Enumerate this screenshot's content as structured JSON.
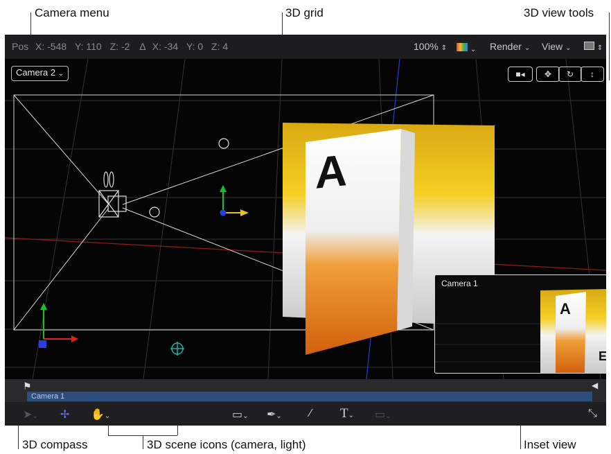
{
  "callouts": {
    "camera_menu": "Camera menu",
    "grid_3d": "3D grid",
    "view_tools": "3D view tools",
    "compass": "3D compass",
    "scene_icons": "3D scene icons (camera, light)",
    "inset_view": "Inset view"
  },
  "status": {
    "pos_label": "Pos",
    "x": "X: -548",
    "y": "Y: 110",
    "z": "Z: -2",
    "delta": "Δ",
    "dx": "X: -34",
    "dy": "Y: 0",
    "dz": "Z: 4",
    "zoom": "100%",
    "render": "Render",
    "view": "View"
  },
  "camera_menu": {
    "selected": "Camera 2"
  },
  "poster": {
    "letter": "A"
  },
  "timeline": {
    "track_label": "Camera 1"
  },
  "inset": {
    "title": "Camera 1",
    "letter": "A",
    "corner_letter": "E"
  },
  "icons": {
    "camera_tool": "video-camera-icon",
    "move_tool": "move-arrows-icon",
    "orbit_tool": "orbit-icon",
    "dolly_tool": "dolly-icon",
    "select": "arrow-pointer-icon",
    "compass": "3d-transform-icon",
    "pan": "hand-icon",
    "shape": "rectangle-icon",
    "pen": "pen-icon",
    "brush": "paint-brush-icon",
    "text": "text-icon",
    "mask": "mask-icon",
    "fullscreen": "expand-icon"
  },
  "colors": {
    "poster_yellow": "#f2c21b",
    "poster_orange": "#e8741a",
    "track": "#2d4e7c"
  }
}
